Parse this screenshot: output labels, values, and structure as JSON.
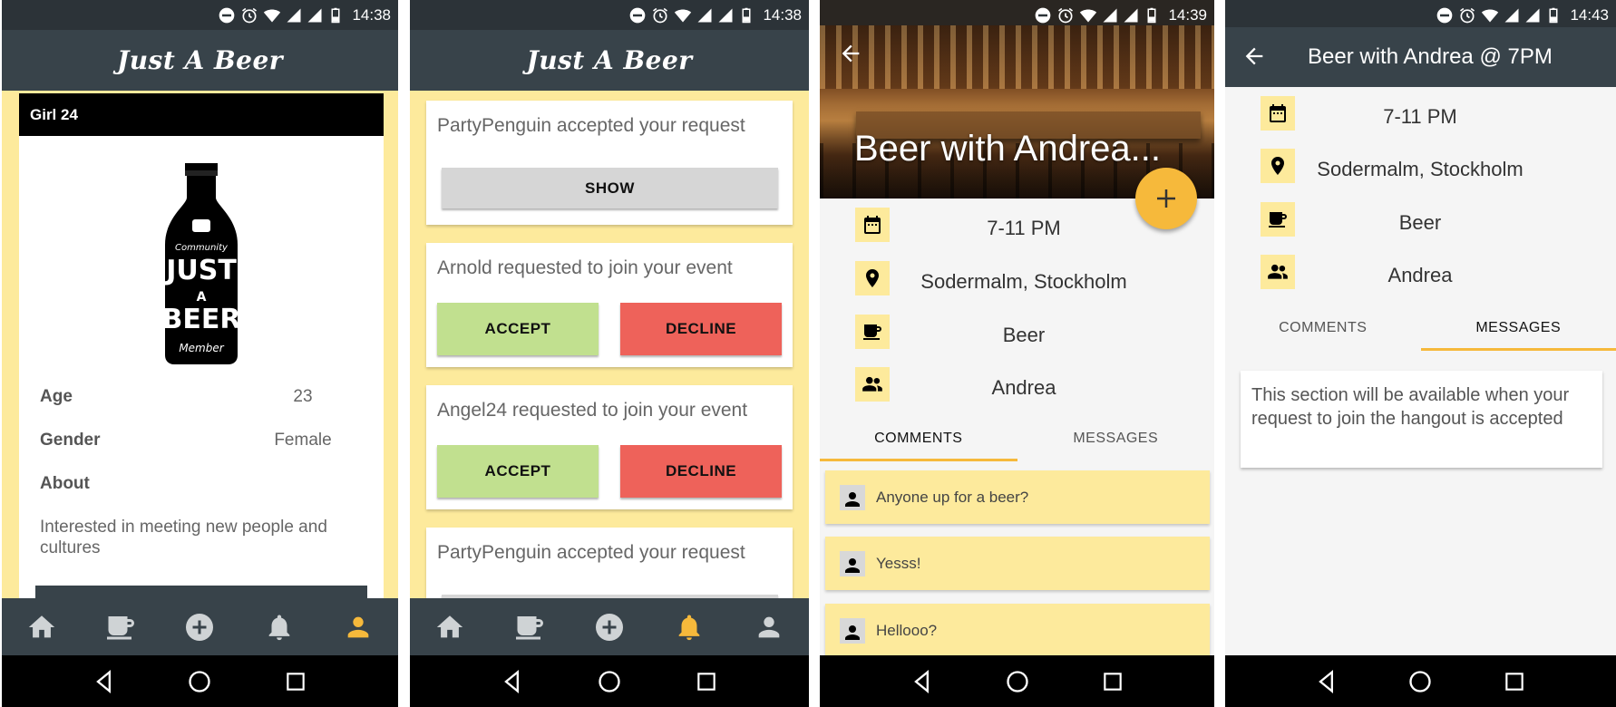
{
  "app": {
    "brand": "Just A Beer"
  },
  "status": {
    "time1": "14:38",
    "time2": "14:38",
    "time3": "14:39",
    "time4": "14:43"
  },
  "nav_icons": [
    "home-icon",
    "beer-mug-icon",
    "add-circle-icon",
    "bell-icon",
    "person-icon"
  ],
  "profile": {
    "header": "Girl 24",
    "logo_text": [
      "Community",
      "JUST",
      "A",
      "BEER",
      "Member"
    ],
    "age_label": "Age",
    "age_value": "23",
    "gender_label": "Gender",
    "gender_value": "Female",
    "about_label": "About",
    "about_text": "Interested in meeting new people and cultures"
  },
  "notifications": [
    {
      "text": "PartyPenguin accepted your request",
      "show_label": "SHOW"
    },
    {
      "text": "Arnold requested to join your event",
      "accept_label": "ACCEPT",
      "decline_label": "DECLINE"
    },
    {
      "text": "Angel24 requested to join your event",
      "accept_label": "ACCEPT",
      "decline_label": "DECLINE"
    },
    {
      "text": "PartyPenguin accepted your request"
    }
  ],
  "event": {
    "hero_title": "Beer with Andrea...",
    "time": "7-11 PM",
    "location": "Sodermalm, Stockholm",
    "drink": "Beer",
    "people": "Andrea",
    "tab_comments": "COMMENTS",
    "tab_messages": "MESSAGES",
    "comments": [
      "Anyone up for a beer?",
      "Yesss!",
      "Hellooo?"
    ]
  },
  "event_detail": {
    "title": "Beer with Andrea @ 7PM",
    "time": "7-11 PM",
    "location": "Sodermalm, Stockholm",
    "drink": "Beer",
    "people": "Andrea",
    "tab_comments": "COMMENTS",
    "tab_messages": "MESSAGES",
    "messages_notice": "This section will be available when your request to join the hangout is accepted"
  },
  "colors": {
    "accent": "#f6b93b",
    "dark": "#38434a",
    "yellow": "#fdea9c",
    "accept": "#c1e08f",
    "decline": "#ee625a"
  }
}
